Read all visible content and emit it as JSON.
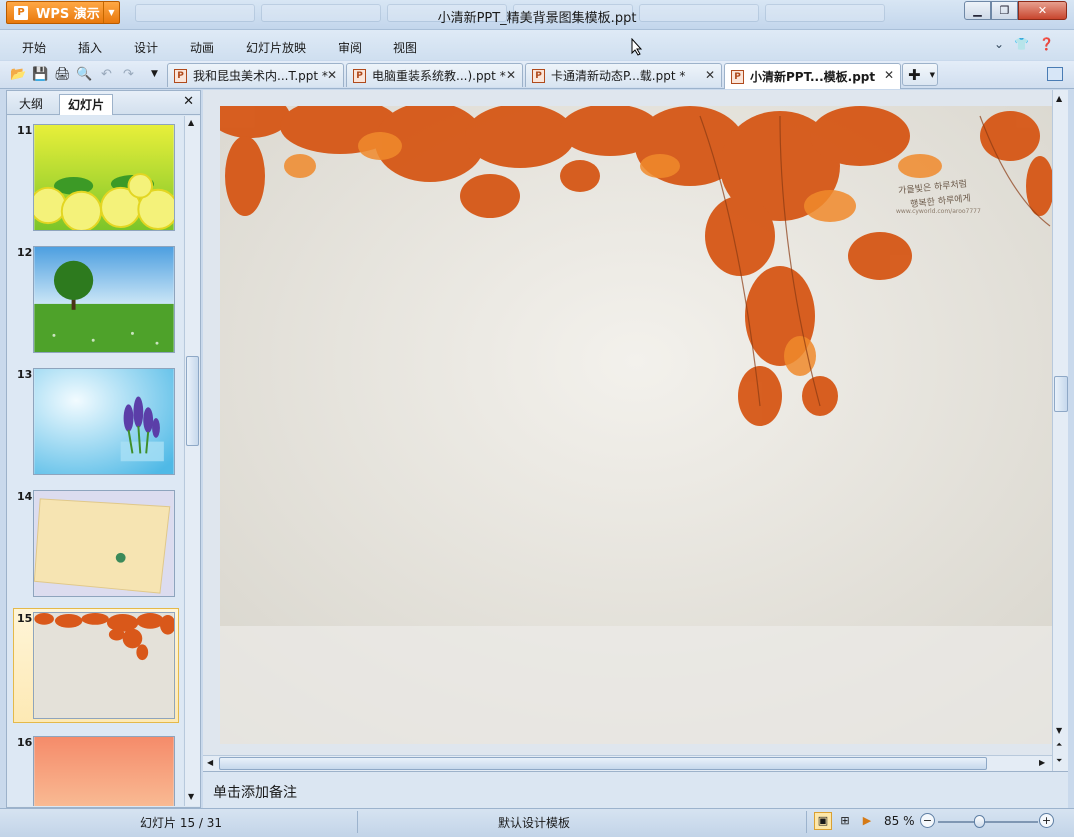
{
  "window": {
    "app_name": "WPS 演示",
    "title": "小清新PPT_精美背景图集模板.ppt",
    "min_icon": "minimize-icon",
    "max_icon": "maximize-icon",
    "close_icon": "close-icon"
  },
  "menu": {
    "items": [
      "开始",
      "插入",
      "设计",
      "动画",
      "幻灯片放映",
      "审阅",
      "视图"
    ],
    "right_icons": [
      "chevron-down-icon",
      "skin-icon",
      "help-icon"
    ]
  },
  "toolbar": {
    "icons": [
      "open-folder-icon",
      "save-icon",
      "print-icon",
      "print-preview-icon",
      "undo-icon",
      "redo-icon",
      "customize-dropdown-icon"
    ]
  },
  "doc_tabs": [
    {
      "label": "我和昆虫美术内...T.ppt *",
      "active": false
    },
    {
      "label": "电脑重装系统教...).ppt *",
      "active": false
    },
    {
      "label": "卡通清新动态P...载.ppt *",
      "active": false
    },
    {
      "label": "小清新PPT...模板.ppt",
      "active": true
    }
  ],
  "left_panel": {
    "tabs": [
      "大纲",
      "幻灯片"
    ],
    "active_tab": "幻灯片",
    "thumbnails": [
      {
        "num": "11",
        "scene": "lemon slices"
      },
      {
        "num": "12",
        "scene": "green tree"
      },
      {
        "num": "13",
        "scene": "lavender flowers"
      },
      {
        "num": "14",
        "scene": "paper envelope"
      },
      {
        "num": "15",
        "scene": "autumn leaves"
      },
      {
        "num": "16",
        "scene": "sunset"
      }
    ],
    "selected": "15"
  },
  "slide": {
    "watermark_line1": "가을빛은 하루처럼",
    "watermark_line2": "행복한 하루에게",
    "watermark_url": "www.cyworld.com/aroo7777"
  },
  "notes": {
    "placeholder": "单击添加备注"
  },
  "status": {
    "slides": "幻灯片 15 / 31",
    "template": "默认设计模板",
    "zoom": "85 %"
  },
  "colors": {
    "accent": "#e8780c",
    "leaf": "#d9581a"
  }
}
